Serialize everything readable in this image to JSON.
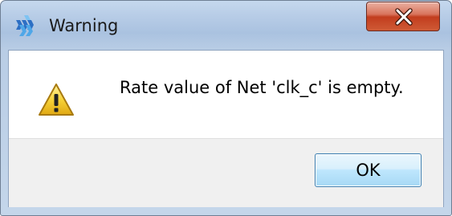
{
  "window": {
    "title": "Warning",
    "title_icon": "gowin-logo-icon",
    "close_glyph": "x"
  },
  "dialog": {
    "icon": "warning-triangle-icon",
    "message": "Rate value of Net 'clk_c' is empty."
  },
  "buttons": {
    "ok_label": "OK"
  },
  "colors": {
    "titlebar": "#b8cde7",
    "close_button": "#c8452a",
    "ok_button": "#bee6fd",
    "warning_yellow": "#f7d33a"
  }
}
